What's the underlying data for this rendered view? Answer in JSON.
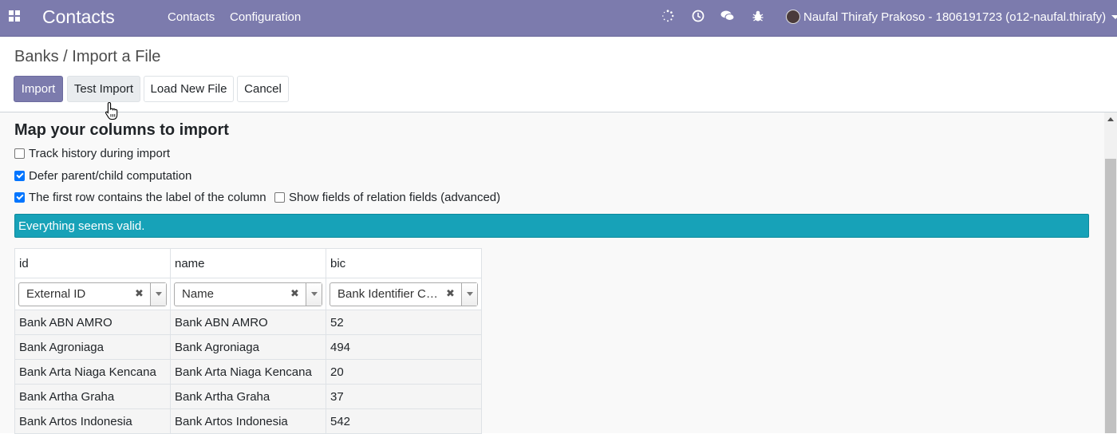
{
  "navbar": {
    "app_name": "Contacts",
    "menu": [
      "Contacts",
      "Configuration"
    ],
    "user_name": "Naufal Thirafy Prakoso - 1806191723 (o12-naufal.thirafy)",
    "color": "#7c7bad"
  },
  "breadcrumb": {
    "parent": "Banks",
    "separator": "/",
    "current": "Import a File"
  },
  "buttons": {
    "import": "Import",
    "test_import": "Test Import",
    "load_new_file": "Load New File",
    "cancel": "Cancel"
  },
  "options": {
    "title": "Map your columns to import",
    "track_history": {
      "label": "Track history during import",
      "checked": false
    },
    "defer_parent": {
      "label": "Defer parent/child computation",
      "checked": true
    },
    "first_row_header": {
      "label": "The first row contains the label of the column",
      "checked": true
    },
    "show_relation_fields": {
      "label": "Show fields of relation fields (advanced)",
      "checked": false
    }
  },
  "alert": {
    "message": "Everything seems valid.",
    "color": "#17a2b8"
  },
  "table": {
    "columns": [
      {
        "header": "id",
        "mapped_field": "External ID"
      },
      {
        "header": "name",
        "mapped_field": "Name"
      },
      {
        "header": "bic",
        "mapped_field": "Bank Identifier Co..."
      }
    ],
    "rows": [
      [
        "Bank ABN AMRO",
        "Bank ABN AMRO",
        "52"
      ],
      [
        "Bank Agroniaga",
        "Bank Agroniaga",
        "494"
      ],
      [
        "Bank Arta Niaga Kencana",
        "Bank Arta Niaga Kencana",
        "20"
      ],
      [
        "Bank Artha Graha",
        "Bank Artha Graha",
        "37"
      ],
      [
        "Bank Artos Indonesia",
        "Bank Artos Indonesia",
        "542"
      ]
    ]
  }
}
